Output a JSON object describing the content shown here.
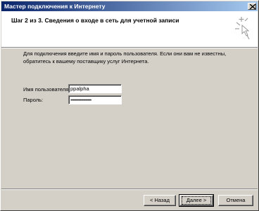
{
  "window": {
    "title": "Мастер подключения к Интернету"
  },
  "header": {
    "step_title": "Шаг 2 из 3. Сведения о входе в сеть для учетной записи"
  },
  "main": {
    "instructions": "Для подключения введите имя и пароль пользователя. Если они вам не известны, обратитесь к вашему поставщику услуг Интернета.",
    "username_label": "Имя пользователя:",
    "username_value": "ppalpha",
    "password_label": "Пароль:",
    "password_value": "••••••••••••••••••"
  },
  "buttons": {
    "back": "< Назад",
    "next": "Далее >",
    "cancel": "Отмена"
  }
}
